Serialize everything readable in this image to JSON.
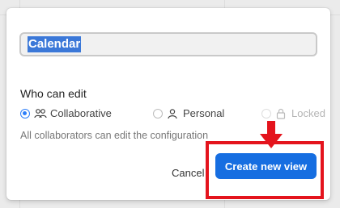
{
  "view_name": {
    "value": "Calendar"
  },
  "permissions": {
    "label": "Who can edit",
    "options": [
      {
        "label": "Collaborative",
        "icon": "collaborators-icon",
        "selected": true,
        "disabled": false
      },
      {
        "label": "Personal",
        "icon": "person-icon",
        "selected": false,
        "disabled": false
      },
      {
        "label": "Locked",
        "icon": "lock-icon",
        "selected": false,
        "disabled": true
      }
    ],
    "helper": "All collaborators can edit the configuration"
  },
  "actions": {
    "cancel_label": "Cancel",
    "create_label": "Create new view"
  },
  "colors": {
    "accent": "#166ee1",
    "annotation": "#e4141d",
    "selection": "#3b78d8"
  }
}
